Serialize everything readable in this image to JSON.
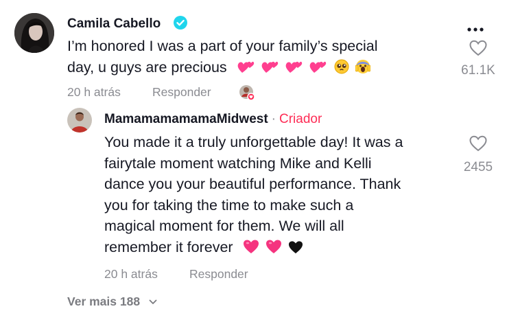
{
  "main_comment": {
    "username": "Camila Cabello",
    "verified_icon": "verified-check-icon",
    "text_line1": "I’m honored I was a part of your family’s special",
    "text_line2": "day, u guys are precious",
    "emojis": [
      "two-hearts-icon",
      "two-hearts-icon",
      "two-hearts-icon",
      "two-hearts-icon",
      "pleading-face-icon",
      "face-screaming-icon"
    ],
    "timestamp": "20 h atrás",
    "reply_label": "Responder",
    "like_count": "61.1K",
    "more_options_icon": "more-options-icon"
  },
  "reply_comment": {
    "username": "MamamamamamaMidwest",
    "separator": "·",
    "creator_label": "Criador",
    "text_lines": [
      "You made it a truly unforgettable day! It was a",
      "fairytale moment watching Mike and Kelli",
      "dance you your beautiful performance. Thank",
      "you for taking the time to make such a",
      "magical moment for them. We will all",
      "remember it forever"
    ],
    "emojis": [
      "pink-heart-icon",
      "pink-heart-icon",
      "black-heart-icon"
    ],
    "timestamp": "20 h atrás",
    "reply_label": "Responder",
    "like_count": "2455"
  },
  "view_more": {
    "label": "Ver mais 188"
  },
  "colors": {
    "text": "#161823",
    "muted": "#8a8b91",
    "creator_accent": "#fe2c55",
    "verified": "#20d5ec"
  }
}
